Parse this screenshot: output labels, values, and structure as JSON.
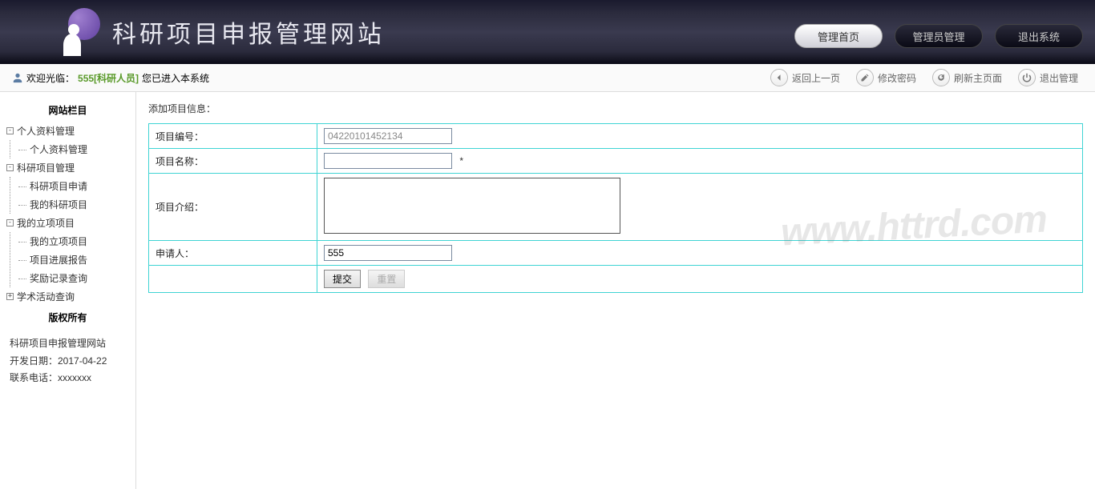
{
  "header": {
    "title": "科研项目申报管理网站",
    "nav": [
      {
        "label": "管理首页",
        "active": true
      },
      {
        "label": "管理员管理",
        "active": false
      },
      {
        "label": "退出系统",
        "active": false
      }
    ]
  },
  "actionbar": {
    "welcome_prefix": "欢迎光临：",
    "user": "555[科研人员]",
    "welcome_suffix": " 您已进入本系统",
    "links": [
      {
        "label": "返回上一页",
        "icon": "arrow-left"
      },
      {
        "label": "修改密码",
        "icon": "pencil"
      },
      {
        "label": "刷新主页面",
        "icon": "refresh"
      },
      {
        "label": "退出管理",
        "icon": "power"
      }
    ]
  },
  "sidebar": {
    "section_title": "网站栏目",
    "groups": [
      {
        "label": "个人资料管理",
        "expanded": true,
        "children": [
          {
            "label": "个人资料管理"
          }
        ]
      },
      {
        "label": "科研项目管理",
        "expanded": true,
        "children": [
          {
            "label": "科研项目申请"
          },
          {
            "label": "我的科研项目"
          }
        ]
      },
      {
        "label": "我的立项项目",
        "expanded": true,
        "children": [
          {
            "label": "我的立项项目"
          },
          {
            "label": "项目进展报告"
          },
          {
            "label": "奖励记录查询"
          }
        ]
      },
      {
        "label": "学术活动查询",
        "expanded": false,
        "children": []
      }
    ],
    "copyright_title": "版权所有",
    "copyright_line1": "科研项目申报管理网站",
    "copyright_line2": "开发日期：2017-04-22",
    "copyright_line3": "联系电话：xxxxxxx"
  },
  "form": {
    "title": "添加项目信息：",
    "rows": {
      "id_label": "项目编号：",
      "id_value": "04220101452134",
      "name_label": "项目名称：",
      "name_value": "",
      "name_required": "*",
      "intro_label": "项目介绍：",
      "intro_value": "",
      "applicant_label": "申请人：",
      "applicant_value": "555"
    },
    "buttons": {
      "submit": "提交",
      "reset": "重置"
    }
  },
  "watermark": "www.httrd.com"
}
